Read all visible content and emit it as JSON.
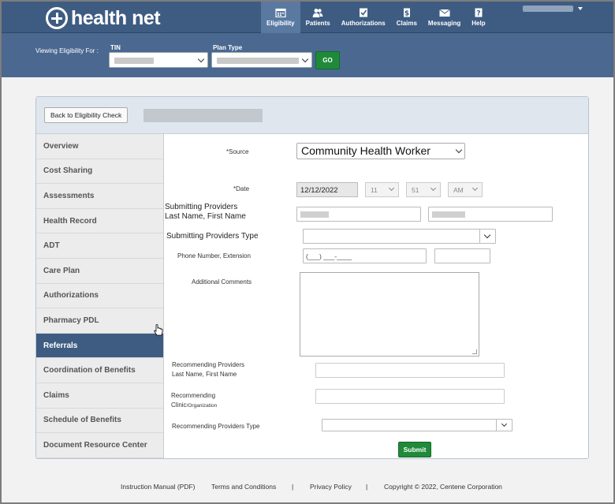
{
  "brand": {
    "name": "health net"
  },
  "nav": [
    {
      "label": "Eligibility",
      "icon": "calendar-icon",
      "active": true
    },
    {
      "label": "Patients",
      "icon": "people-icon"
    },
    {
      "label": "Authorizations",
      "icon": "checkbox-icon"
    },
    {
      "label": "Claims",
      "icon": "dollar-document-icon"
    },
    {
      "label": "Messaging",
      "icon": "envelope-icon"
    },
    {
      "label": "Help",
      "icon": "question-icon"
    }
  ],
  "filter": {
    "viewing_label": "Viewing Eligibility For :",
    "tin_label": "TIN",
    "plan_label": "Plan Type",
    "go_label": "GO"
  },
  "card": {
    "back_label": "Back to Eligibility Check"
  },
  "sidebar": {
    "items": [
      {
        "label": "Overview"
      },
      {
        "label": "Cost Sharing"
      },
      {
        "label": "Assessments"
      },
      {
        "label": "Health Record"
      },
      {
        "label": "ADT"
      },
      {
        "label": "Care Plan"
      },
      {
        "label": "Authorizations"
      },
      {
        "label": "Pharmacy PDL"
      },
      {
        "label": "Referrals",
        "active": true
      },
      {
        "label": "Coordination of Benefits"
      },
      {
        "label": "Claims"
      },
      {
        "label": "Schedule of Benefits"
      },
      {
        "label": "Document Resource Center"
      }
    ]
  },
  "form": {
    "source_label": "*Source",
    "source_value": "Community Health Worker",
    "date_label": "*Date",
    "date_value": "12/12/2022",
    "hour_value": "11",
    "minute_value": "51",
    "ampm_value": "AM",
    "submitting_providers_label_1": "Submitting Providers",
    "submitting_providers_label_2": "Last Name, First Name",
    "submitting_type_label": "Submitting Providers Type",
    "phone_label": "Phone Number, Extension",
    "phone_placeholder": "(___) ___-____",
    "comments_label": "Additional Comments",
    "recommending_providers_label_1": "Recommending Providers",
    "recommending_providers_label_2": "Last Name, First Name",
    "recommending_clinic_label_1": "Recommending",
    "recommending_clinic_label_2a": "Clinic",
    "recommending_clinic_label_2b": "/Organization",
    "recommending_type_label": "Recommending Providers Type",
    "submit_label": "Submit"
  },
  "footer": {
    "manual": "Instruction Manual (PDF)",
    "terms": "Terms and Conditions",
    "sep": "|",
    "privacy": "Privacy Policy",
    "copyright": "Copyright © 2022, Centene Corporation"
  }
}
